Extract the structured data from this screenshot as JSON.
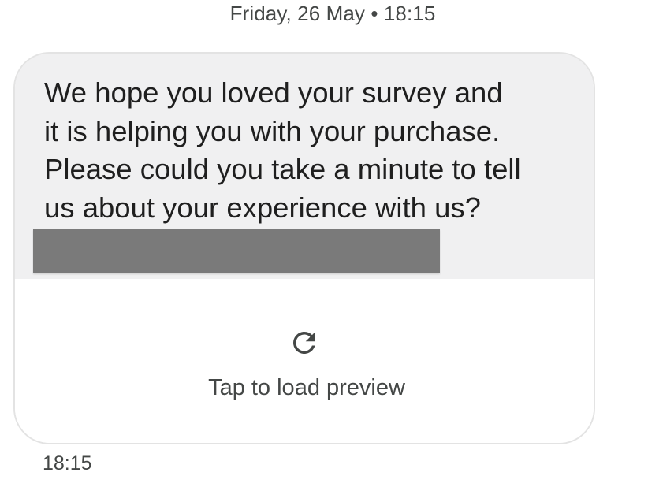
{
  "conversation": {
    "date_header": "Friday, 26 May • 18:15"
  },
  "message": {
    "lines": [
      "We hope you loved your survey and",
      "it is helping you with your purchase.",
      "Please could you take a minute to tell",
      "us about your experience with us?"
    ],
    "link_redacted": true,
    "preview": {
      "icon": "refresh-icon",
      "label": "Tap to load preview"
    },
    "timestamp": "18:15"
  },
  "colors": {
    "bubble_background": "#f0f0f1",
    "redaction": "#7a7a7a",
    "text_primary": "#1f1f1f",
    "text_secondary": "#444746"
  }
}
